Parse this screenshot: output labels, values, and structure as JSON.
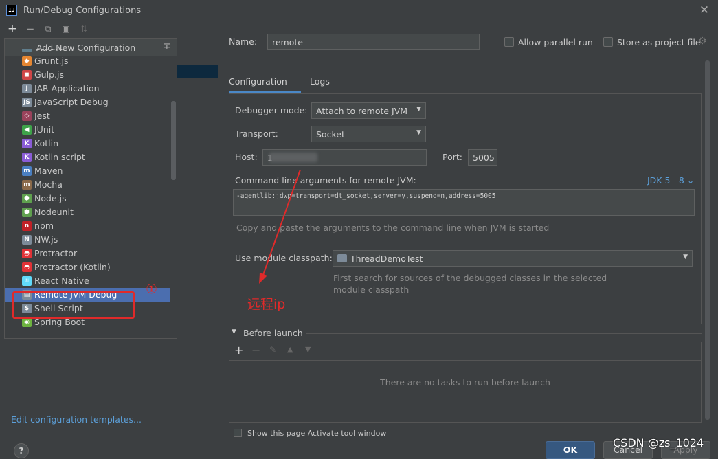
{
  "window": {
    "title": "Run/Debug Configurations",
    "app_icon_text": "IJ"
  },
  "left_panel": {
    "dropdown_title": "Add New Configuration",
    "items": [
      {
        "label": "Gradle",
        "icon": "gradle-icon",
        "color": "#5f7d8c"
      },
      {
        "label": "Grunt.js",
        "icon": "grunt-icon",
        "color": "#e48632"
      },
      {
        "label": "Gulp.js",
        "icon": "gulp-icon",
        "color": "#cf4647"
      },
      {
        "label": "JAR Application",
        "icon": "jar-icon",
        "color": "#7d8b99"
      },
      {
        "label": "JavaScript Debug",
        "icon": "javascript-debug-icon",
        "color": "#7d8b99"
      },
      {
        "label": "Jest",
        "icon": "jest-icon",
        "color": "#99425b"
      },
      {
        "label": "JUnit",
        "icon": "junit-icon",
        "color": "#3ea34a"
      },
      {
        "label": "Kotlin",
        "icon": "kotlin-icon",
        "color": "#8a5cd6"
      },
      {
        "label": "Kotlin script",
        "icon": "kotlin-script-icon",
        "color": "#8a5cd6"
      },
      {
        "label": "Maven",
        "icon": "maven-icon",
        "color": "#4a7fc1"
      },
      {
        "label": "Mocha",
        "icon": "mocha-icon",
        "color": "#8b6a4a"
      },
      {
        "label": "Node.js",
        "icon": "nodejs-icon",
        "color": "#5fa04e"
      },
      {
        "label": "Nodeunit",
        "icon": "nodeunit-icon",
        "color": "#5fa04e"
      },
      {
        "label": "npm",
        "icon": "npm-icon",
        "color": "#c12127"
      },
      {
        "label": "NW.js",
        "icon": "nwjs-icon",
        "color": "#7d8b99"
      },
      {
        "label": "Protractor",
        "icon": "protractor-icon",
        "color": "#e23237"
      },
      {
        "label": "Protractor (Kotlin)",
        "icon": "protractor-kotlin-icon",
        "color": "#e23237"
      },
      {
        "label": "React Native",
        "icon": "react-native-icon",
        "color": "#61dafb"
      },
      {
        "label": "Remote JVM Debug",
        "icon": "remote-jvm-debug-icon",
        "color": "#7d8b99"
      },
      {
        "label": "Shell Script",
        "icon": "shell-script-icon",
        "color": "#7d8b99"
      },
      {
        "label": "Spring Boot",
        "icon": "spring-boot-icon",
        "color": "#6db33f"
      }
    ],
    "selected_index": 18,
    "edit_templates": "Edit configuration templates..."
  },
  "form": {
    "name_label": "Name:",
    "name_value": "remote",
    "allow_parallel_label": "Allow parallel run",
    "store_as_file_label": "Store as project file",
    "tabs": [
      "Configuration",
      "Logs"
    ],
    "debugger_mode_label": "Debugger mode:",
    "debugger_mode_value": "Attach to remote JVM",
    "transport_label": "Transport:",
    "transport_value": "Socket",
    "host_label": "Host:",
    "host_value": "1",
    "port_label": "Port:",
    "port_value": "5005",
    "cmd_label": "Command line arguments for remote JVM:",
    "jdk_link": "JDK 5 - 8 ⌄",
    "cmd_value": "-agentlib:jdwp=transport=dt_socket,server=y,suspend=n,address=5005",
    "cmd_hint": "Copy and paste the arguments to the command line when JVM is started",
    "module_label": "Use module classpath:",
    "module_value": "ThreadDemoTest",
    "module_hint": "First search for sources of the debugged classes in the selected module classpath",
    "before_launch_label": "Before launch",
    "no_tasks": "There are no tasks to run before launch",
    "peek_row": "Show this page     Activate tool window"
  },
  "annotations": {
    "box_number": "①",
    "ip_note": "远程ip"
  },
  "buttons": {
    "ok": "OK",
    "cancel": "Cancel",
    "apply": "Apply",
    "help": "?"
  },
  "watermark": "CSDN @zs_1024"
}
